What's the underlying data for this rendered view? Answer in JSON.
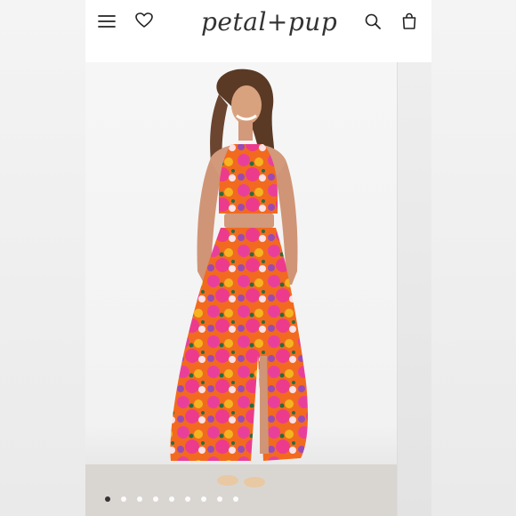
{
  "brand": {
    "logo_text": "petal+pup"
  },
  "header": {
    "menu_icon": "hamburger-menu-icon",
    "wishlist_icon": "heart-icon",
    "search_icon": "search-icon",
    "bag_icon": "shopping-bag-icon"
  },
  "product_image": {
    "description_icon": "model-photo",
    "carousel": {
      "total": 9,
      "active_index": 1
    }
  },
  "colors": {
    "dress_pink": "#e8409a",
    "dress_orange": "#f26a1f",
    "dress_yellow": "#f5b41f",
    "dress_purple": "#9b4ab5",
    "background": "#f3f3f3"
  }
}
